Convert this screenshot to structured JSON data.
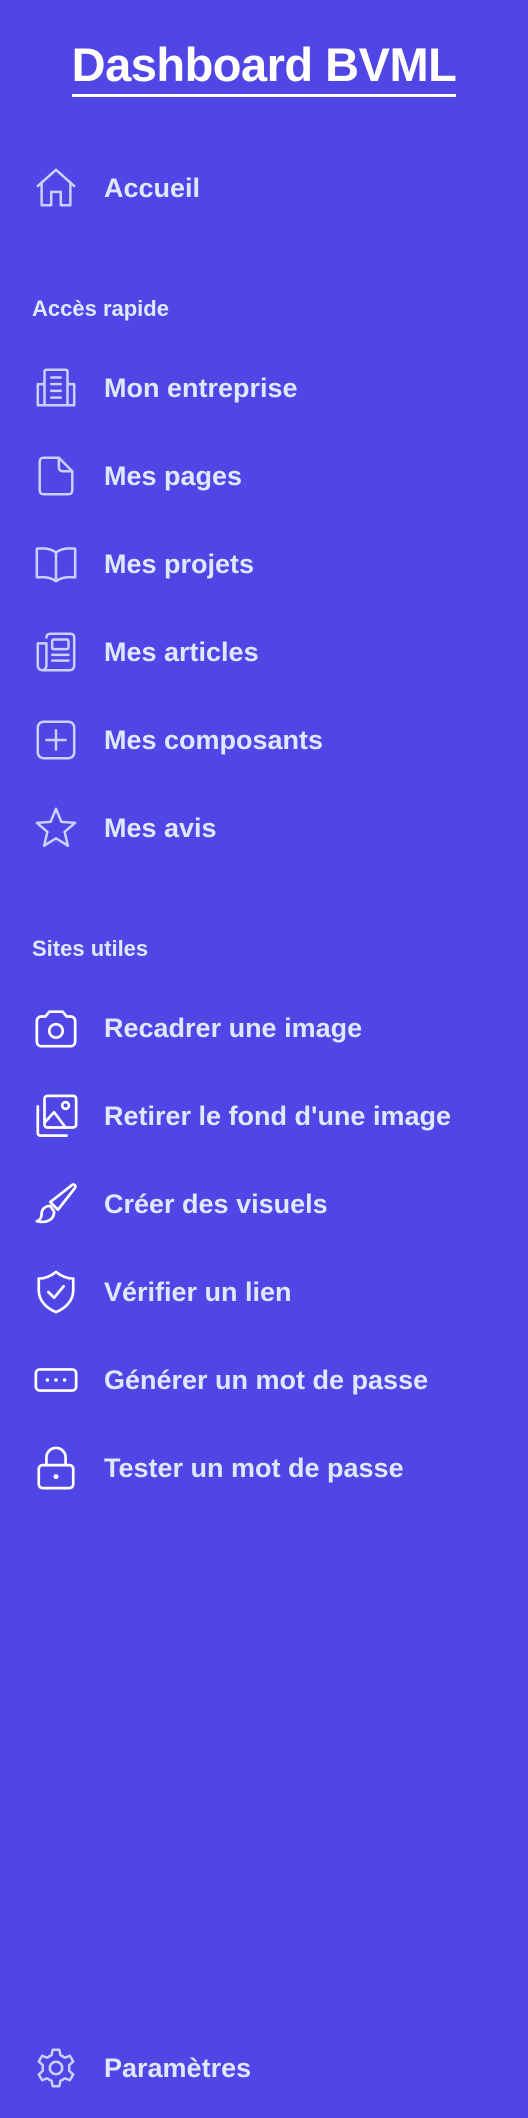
{
  "app": {
    "title": "Dashboard BVML"
  },
  "nav": {
    "home_label": "Accueil"
  },
  "quick_access": {
    "heading": "Accès rapide",
    "items": [
      {
        "label": "Mon entreprise",
        "icon": "building-icon"
      },
      {
        "label": "Mes pages",
        "icon": "document-icon"
      },
      {
        "label": "Mes projets",
        "icon": "book-open-icon"
      },
      {
        "label": "Mes articles",
        "icon": "newspaper-icon"
      },
      {
        "label": "Mes composants",
        "icon": "plus-square-icon"
      },
      {
        "label": "Mes avis",
        "icon": "star-icon"
      }
    ]
  },
  "useful_sites": {
    "heading": "Sites utiles",
    "items": [
      {
        "label": "Recadrer une image",
        "icon": "camera-icon"
      },
      {
        "label": "Retirer le fond d'une image",
        "icon": "photos-icon"
      },
      {
        "label": "Créer des visuels",
        "icon": "paintbrush-icon"
      },
      {
        "label": "Vérifier un lien",
        "icon": "shield-check-icon"
      },
      {
        "label": "Générer un mot de passe",
        "icon": "password-dots-icon"
      },
      {
        "label": "Tester un mot de passe",
        "icon": "lock-icon"
      }
    ]
  },
  "footer": {
    "settings_label": "Paramètres",
    "icon": "gear-icon"
  },
  "colors": {
    "background": "#4f46e5",
    "text": "#e0e7ff",
    "title": "#ffffff"
  }
}
